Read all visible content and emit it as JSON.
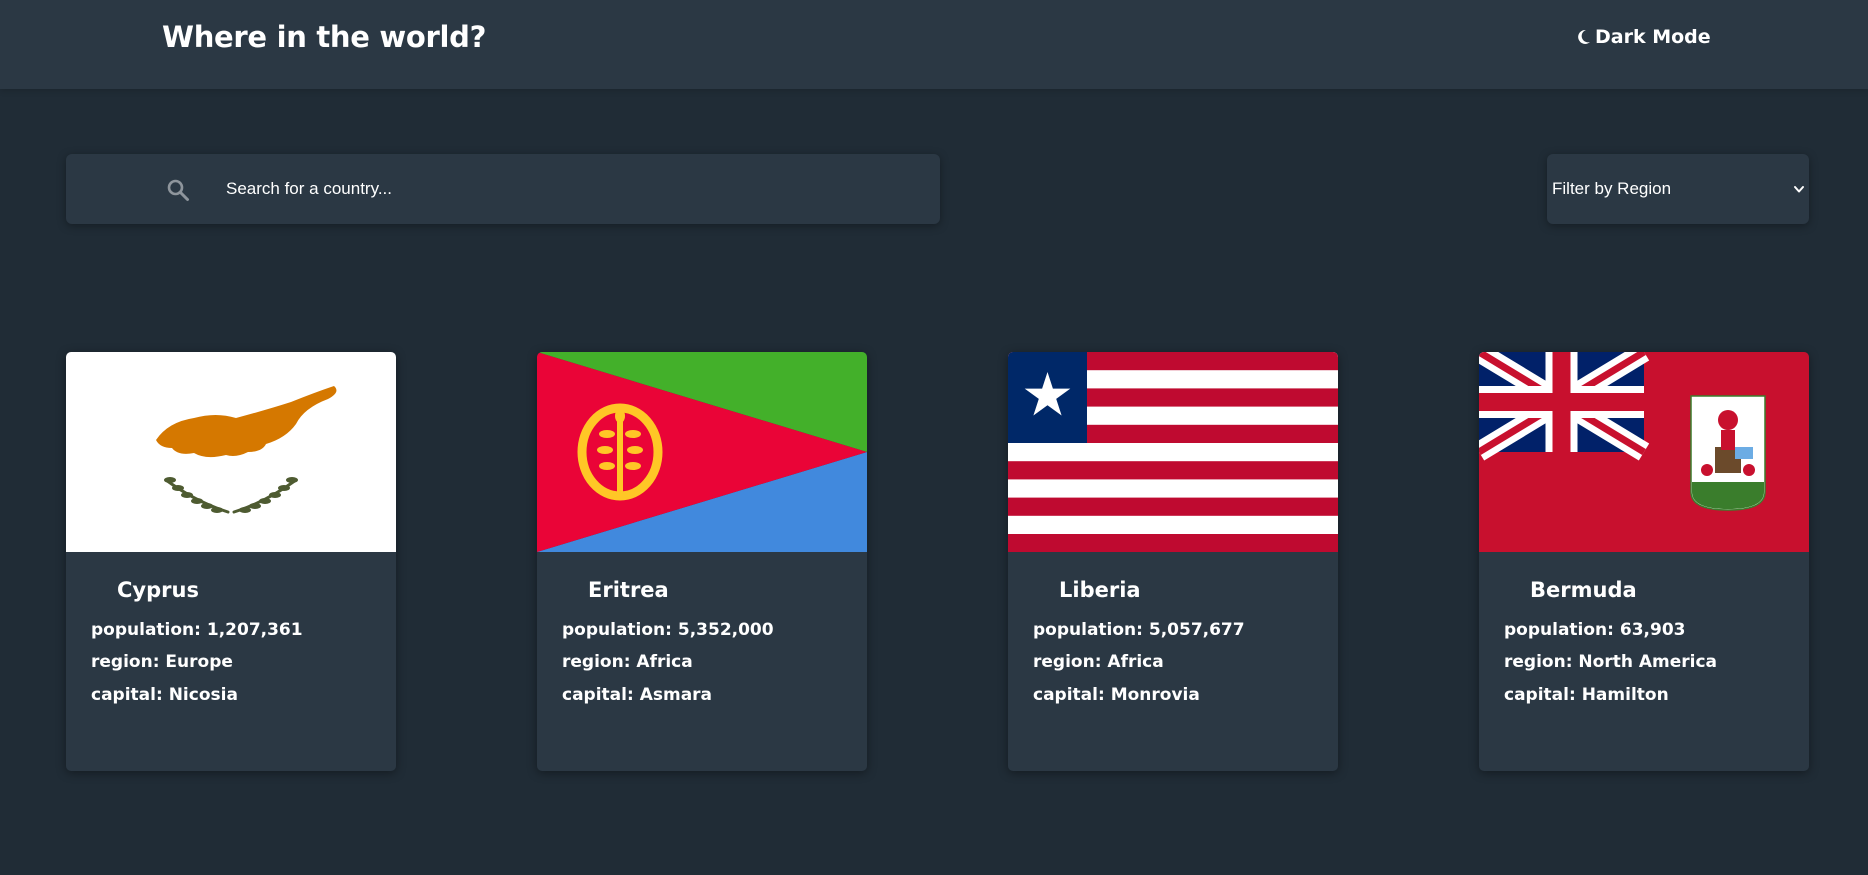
{
  "header": {
    "title": "Where in the world?",
    "theme_toggle_label": "Dark Mode",
    "theme_icon": "moon-icon"
  },
  "search": {
    "placeholder": "Search for a country...",
    "value": "",
    "icon": "search-icon"
  },
  "filter": {
    "selected_label": "Filter by Region",
    "icon": "chevron-down-icon"
  },
  "labels": {
    "population": "population:",
    "region": "region:",
    "capital": "capital:"
  },
  "countries": [
    {
      "name": "Cyprus",
      "population": "1,207,361",
      "region": "Europe",
      "capital": "Nicosia"
    },
    {
      "name": "Eritrea",
      "population": "5,352,000",
      "region": "Africa",
      "capital": "Asmara"
    },
    {
      "name": "Liberia",
      "population": "5,057,677",
      "region": "Africa",
      "capital": "Monrovia"
    },
    {
      "name": "Bermuda",
      "population": "63,903",
      "region": "North America",
      "capital": "Hamilton"
    }
  ],
  "colors": {
    "background": "#202c36",
    "surface": "#2b3844",
    "text": "#ffffff"
  }
}
